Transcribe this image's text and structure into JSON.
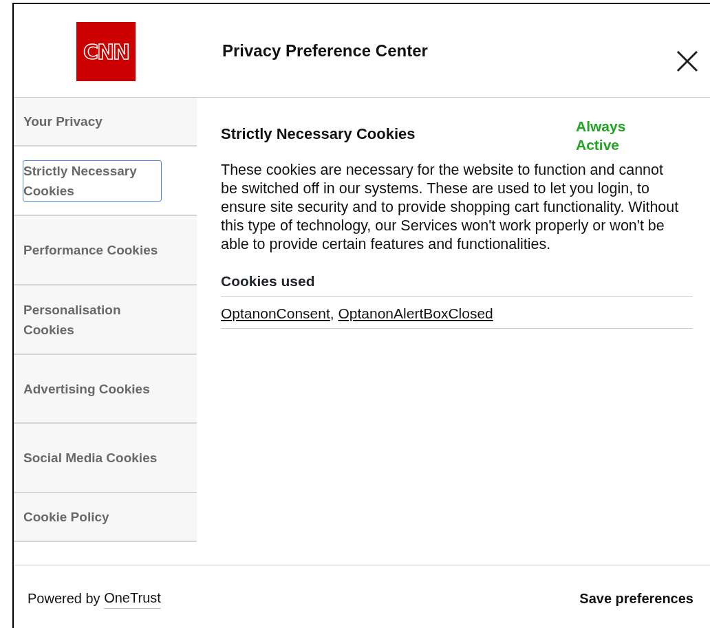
{
  "header": {
    "logo": "CNN",
    "title": "Privacy Preference Center"
  },
  "sidebar": {
    "items": [
      {
        "label": "Your Privacy",
        "selected": false
      },
      {
        "label": "Strictly Necessary Cookies",
        "selected": true
      },
      {
        "label": "Performance Cookies",
        "selected": false
      },
      {
        "label": "Personalisation Cookies",
        "selected": false
      },
      {
        "label": "Advertising Cookies",
        "selected": false
      },
      {
        "label": "Social Media Cookies",
        "selected": false
      },
      {
        "label": "Cookie Policy",
        "selected": false
      }
    ]
  },
  "content": {
    "title": "Strictly Necessary Cookies",
    "status": "Always Active",
    "description": "These cookies are necessary for the website to function and cannot be switched off in our systems. These are used to let you login, to ensure site security and to provide shopping cart functionality. Without this type of technology, our Services won't work properly or won't be able to provide certain features and functionalities.",
    "cookies_heading": "Cookies used",
    "separator": ",",
    "cookies": [
      "OptanonConsent",
      "OptanonAlertBoxClosed"
    ]
  },
  "footer": {
    "powered_by": "Powered by",
    "brand": "OneTrust",
    "save": "Save preferences"
  }
}
